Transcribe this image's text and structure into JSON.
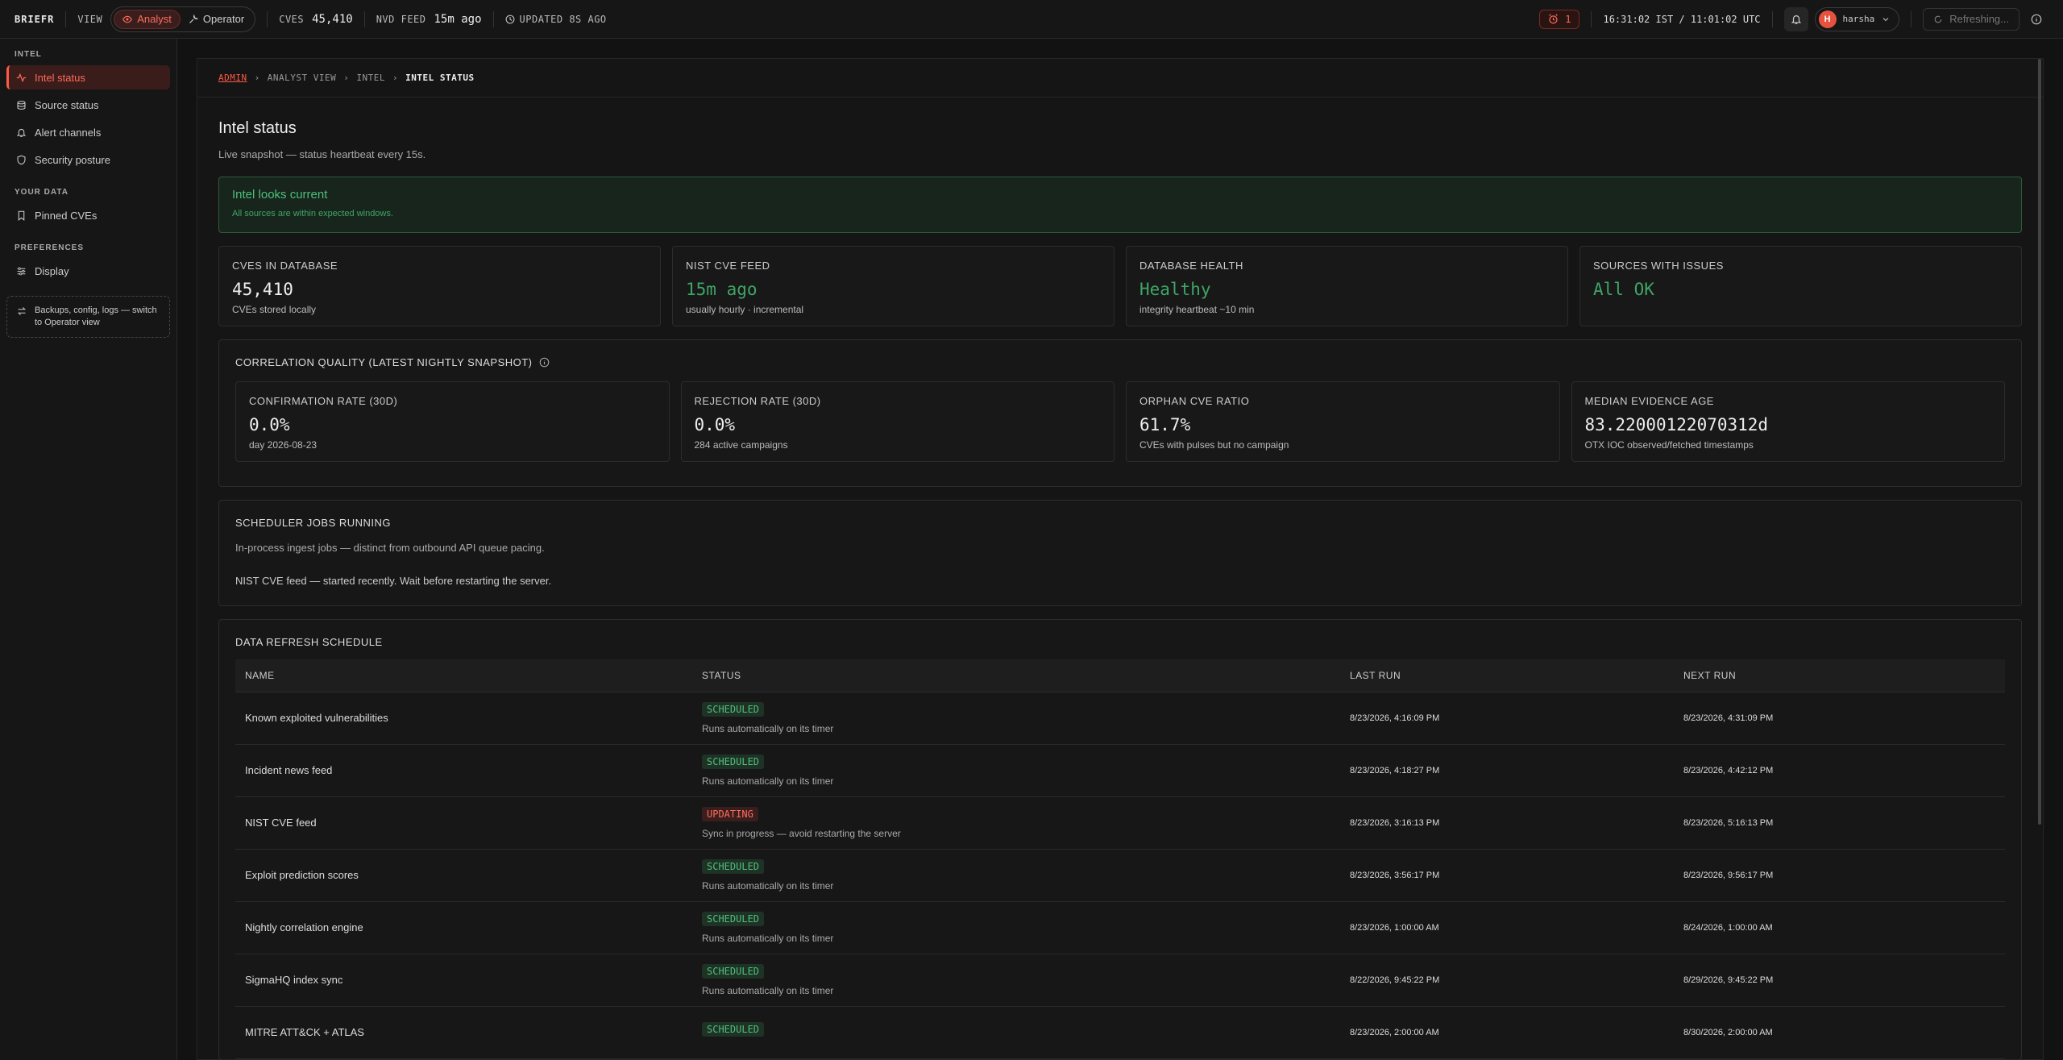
{
  "topbar": {
    "brand": "BRIEFR",
    "view_label": "VIEW",
    "analyst_label": "Analyst",
    "operator_label": "Operator",
    "cves_label": "CVES",
    "cves_value": "45,410",
    "nvd_label": "NVD FEED",
    "nvd_value": "15m ago",
    "updated_label": "UPDATED 8S AGO",
    "alert_count": "1",
    "clock": "16:31:02 IST / 11:01:02 UTC",
    "avatar_initial": "H",
    "username": "harsha",
    "refresh_label": "Refreshing..."
  },
  "sidebar": {
    "sections": [
      {
        "title": "INTEL",
        "items": [
          {
            "label": "Intel status",
            "icon": "activity-icon",
            "active": true
          },
          {
            "label": "Source status",
            "icon": "database-icon"
          },
          {
            "label": "Alert channels",
            "icon": "bell-icon"
          },
          {
            "label": "Security posture",
            "icon": "shield-icon"
          }
        ]
      },
      {
        "title": "YOUR DATA",
        "items": [
          {
            "label": "Pinned CVEs",
            "icon": "bookmark-icon"
          }
        ]
      },
      {
        "title": "PREFERENCES",
        "items": [
          {
            "label": "Display",
            "icon": "sliders-icon"
          }
        ]
      }
    ],
    "hint": "Backups, config, logs — switch to Operator view"
  },
  "breadcrumb": [
    "ADMIN",
    "ANALYST VIEW",
    "INTEL",
    "INTEL STATUS"
  ],
  "page": {
    "title": "Intel status",
    "subtitle": "Live snapshot — status heartbeat every 15s.",
    "banner_title": "Intel looks current",
    "banner_desc": "All sources are within expected windows."
  },
  "summary_cards": [
    {
      "label": "CVES IN DATABASE",
      "value": "45,410",
      "sub": "CVEs stored locally",
      "color": "#eeeeee"
    },
    {
      "label": "NIST CVE FEED",
      "value": "15m ago",
      "sub": "usually hourly · incremental",
      "color": "#3fa566"
    },
    {
      "label": "DATABASE HEALTH",
      "value": "Healthy",
      "sub": "integrity heartbeat ~10 min",
      "color": "#3fa566"
    },
    {
      "label": "SOURCES WITH ISSUES",
      "value": "All OK",
      "sub": "",
      "color": "#3fa566"
    }
  ],
  "correlation": {
    "title": "CORRELATION QUALITY (LATEST NIGHTLY SNAPSHOT)",
    "cards": [
      {
        "label": "CONFIRMATION RATE (30D)",
        "value": "0.0%",
        "sub": "day 2026-08-23"
      },
      {
        "label": "REJECTION RATE (30D)",
        "value": "0.0%",
        "sub": "284 active campaigns"
      },
      {
        "label": "ORPHAN CVE RATIO",
        "value": "61.7%",
        "sub": "CVEs with pulses but no campaign"
      },
      {
        "label": "MEDIAN EVIDENCE AGE",
        "value": "83.22000122070312d",
        "sub": "OTX IOC observed/fetched timestamps"
      }
    ]
  },
  "scheduler": {
    "title": "SCHEDULER JOBS RUNNING",
    "desc": "In-process ingest jobs — distinct from outbound API queue pacing.",
    "note": "NIST CVE feed — started recently. Wait before restarting the server."
  },
  "schedule": {
    "title": "DATA REFRESH SCHEDULE",
    "columns": [
      "NAME",
      "STATUS",
      "LAST RUN",
      "NEXT RUN"
    ],
    "rows": [
      {
        "name": "Known exploited vulnerabilities",
        "status": "SCHEDULED",
        "note": "Runs automatically on its timer",
        "last": "8/23/2026, 4:16:09 PM",
        "next": "8/23/2026, 4:31:09 PM"
      },
      {
        "name": "Incident news feed",
        "status": "SCHEDULED",
        "note": "Runs automatically on its timer",
        "last": "8/23/2026, 4:18:27 PM",
        "next": "8/23/2026, 4:42:12 PM"
      },
      {
        "name": "NIST CVE feed",
        "status": "UPDATING",
        "note": "Sync in progress — avoid restarting the server",
        "last": "8/23/2026, 3:16:13 PM",
        "next": "8/23/2026, 5:16:13 PM"
      },
      {
        "name": "Exploit prediction scores",
        "status": "SCHEDULED",
        "note": "Runs automatically on its timer",
        "last": "8/23/2026, 3:56:17 PM",
        "next": "8/23/2026, 9:56:17 PM"
      },
      {
        "name": "Nightly correlation engine",
        "status": "SCHEDULED",
        "note": "Runs automatically on its timer",
        "last": "8/23/2026, 1:00:00 AM",
        "next": "8/24/2026, 1:00:00 AM"
      },
      {
        "name": "SigmaHQ index sync",
        "status": "SCHEDULED",
        "note": "Runs automatically on its timer",
        "last": "8/22/2026, 9:45:22 PM",
        "next": "8/29/2026, 9:45:22 PM"
      },
      {
        "name": "MITRE ATT&CK + ATLAS",
        "status": "SCHEDULED",
        "note": "",
        "last": "8/23/2026, 2:00:00 AM",
        "next": "8/30/2026, 2:00:00 AM"
      }
    ]
  }
}
